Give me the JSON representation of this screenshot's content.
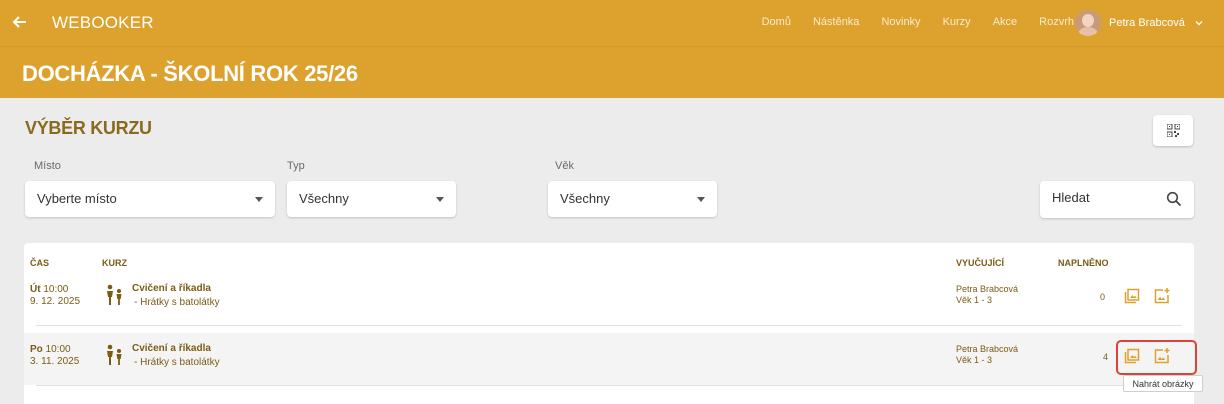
{
  "header": {
    "brand": "WEBOOKER",
    "nav": [
      "Domů",
      "Nástěnka",
      "Novinky",
      "Kurzy",
      "Akce",
      "Rozvrh"
    ],
    "user_name": "Petra Brabcová"
  },
  "page_title": "DOCHÁZKA - ŠKOLNÍ ROK 25/26",
  "section_title": "VÝBĚR KURZU",
  "filters": {
    "place": {
      "label": "Místo",
      "value": "Vyberte místo"
    },
    "type": {
      "label": "Typ",
      "value": "Všechny"
    },
    "age": {
      "label": "Věk",
      "value": "Všechny"
    },
    "search_placeholder": "Hledat"
  },
  "table": {
    "headers": {
      "time": "ČAS",
      "course": "KURZ",
      "teacher": "VYUČUJÍCÍ",
      "filled": "NAPLNĚNO"
    },
    "rows": [
      {
        "day": "Út",
        "time": "10:00",
        "date": "9. 12. 2025",
        "course": "Cvičení a říkadla",
        "sub": "- Hrátky s batolátky",
        "teacher": "Petra Brabcová",
        "age": "Věk 1 - 3",
        "count": "0"
      },
      {
        "day": "Po",
        "time": "10:00",
        "date": "3. 11. 2025",
        "course": "Cvičení a říkadla",
        "sub": "- Hrátky s batolátky",
        "teacher": "Petra Brabcová",
        "age": "Věk 1 - 3",
        "count": "4"
      }
    ]
  },
  "tooltip": "Nahrát obrázky",
  "colors": {
    "accent": "#dda22d",
    "text_brown": "#7a5c14",
    "highlight": "#d9443a"
  }
}
